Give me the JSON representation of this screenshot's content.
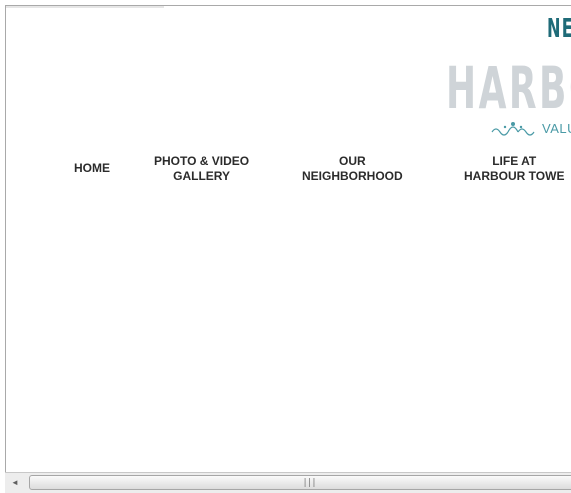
{
  "logo": {
    "top_text": "NE",
    "main_text": "HARBO",
    "tagline": "VALU",
    "ornament_icon": "scroll-ornament",
    "top_color": "#1f6b78",
    "main_color": "#cfd4d8",
    "tagline_color": "#4a9aa6"
  },
  "nav": [
    {
      "lines": [
        "HOME"
      ]
    },
    {
      "lines": [
        "PHOTO & VIDEO",
        "GALLERY"
      ]
    },
    {
      "lines": [
        "OUR",
        "NEIGHBORHOOD"
      ]
    },
    {
      "lines": [
        "LIFE AT",
        "HARBOUR TOWE"
      ]
    }
  ],
  "scrollbar": {
    "left_arrow": "◄",
    "grip": "|||"
  }
}
